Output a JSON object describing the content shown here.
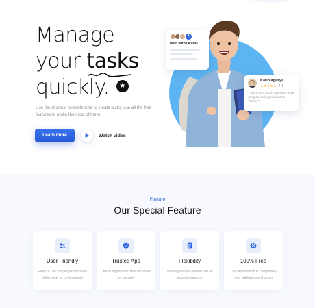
{
  "hero": {
    "headline_line1": "Manage",
    "headline_line2_prefix": "your ",
    "headline_line2_highlight": "tasks",
    "headline_line3": "quickly.",
    "description": "Use the shortest possible time to create tasks, use all the free features to make the most of them",
    "learn_more_label": "Learn more",
    "watch_video_label": "Watch video",
    "icons": {
      "star_badge": "star-icon",
      "play": "play-icon"
    },
    "meet_card": {
      "title": "Meet with Ocams",
      "add_symbol": "+"
    },
    "review_card": {
      "name": "Karin agasya",
      "stars": "★★★★★",
      "score": "4.5",
      "text": "\"I had a very good experience while using the tasking application. Thanks.\""
    },
    "colors": {
      "accent": "#2f66e0",
      "circle": "#5db4f2",
      "star": "#f5a623"
    }
  },
  "features": {
    "eyebrow": "Feature",
    "title": "Our Special Feature",
    "cards": [
      {
        "title": "User Friendly",
        "description": "Easy to use for people who are either new or professional",
        "icon": "users-icon"
      },
      {
        "title": "Trusted App",
        "description": "Official application that is trusted for security",
        "icon": "shield-check-icon"
      },
      {
        "title": "Flexibility",
        "description": "Tasking can be opened on all existing devices",
        "icon": "document-icon"
      },
      {
        "title": "100% Free",
        "description": "This application is completely free, without any charges",
        "icon": "discount-badge-icon"
      }
    ]
  }
}
